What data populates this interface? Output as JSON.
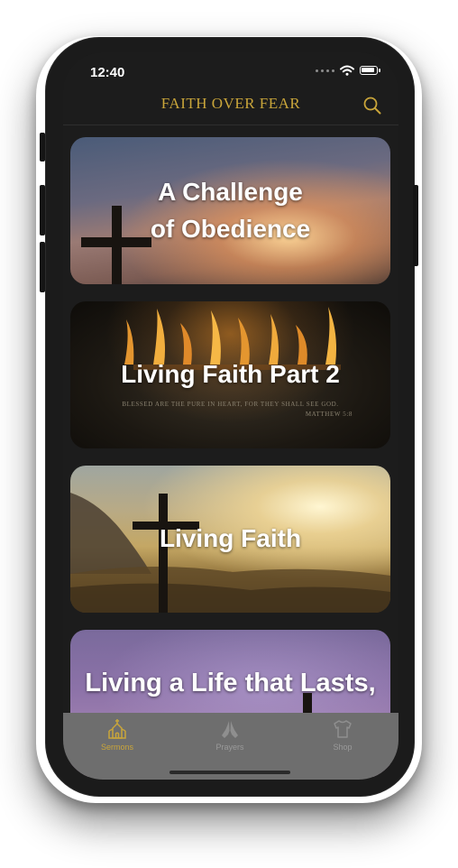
{
  "status_bar": {
    "time": "12:40"
  },
  "header": {
    "title": "FAITH OVER FEAR",
    "search_icon": "search-icon"
  },
  "sermons": [
    {
      "title_lines": [
        "A Challenge",
        "of Obedience"
      ]
    },
    {
      "title_lines": [
        "Living Faith Part 2"
      ],
      "image_caption": "BLESSED ARE THE PURE IN HEART, FOR THEY SHALL SEE GOD.",
      "image_reference": "MATTHEW 5:8"
    },
    {
      "title_lines": [
        "Living Faith"
      ]
    },
    {
      "title_lines": [
        "Living a Life that Lasts,"
      ]
    }
  ],
  "tabs": [
    {
      "label": "Sermons",
      "icon": "church-icon",
      "active": true
    },
    {
      "label": "Prayers",
      "icon": "praying-hands-icon",
      "active": false
    },
    {
      "label": "Shop",
      "icon": "tshirt-icon",
      "active": false
    }
  ],
  "colors": {
    "accent": "#c9a53a",
    "background": "#1c1c1c",
    "tabbar": "#6e6e6e",
    "inactive": "#9a9a9a"
  }
}
